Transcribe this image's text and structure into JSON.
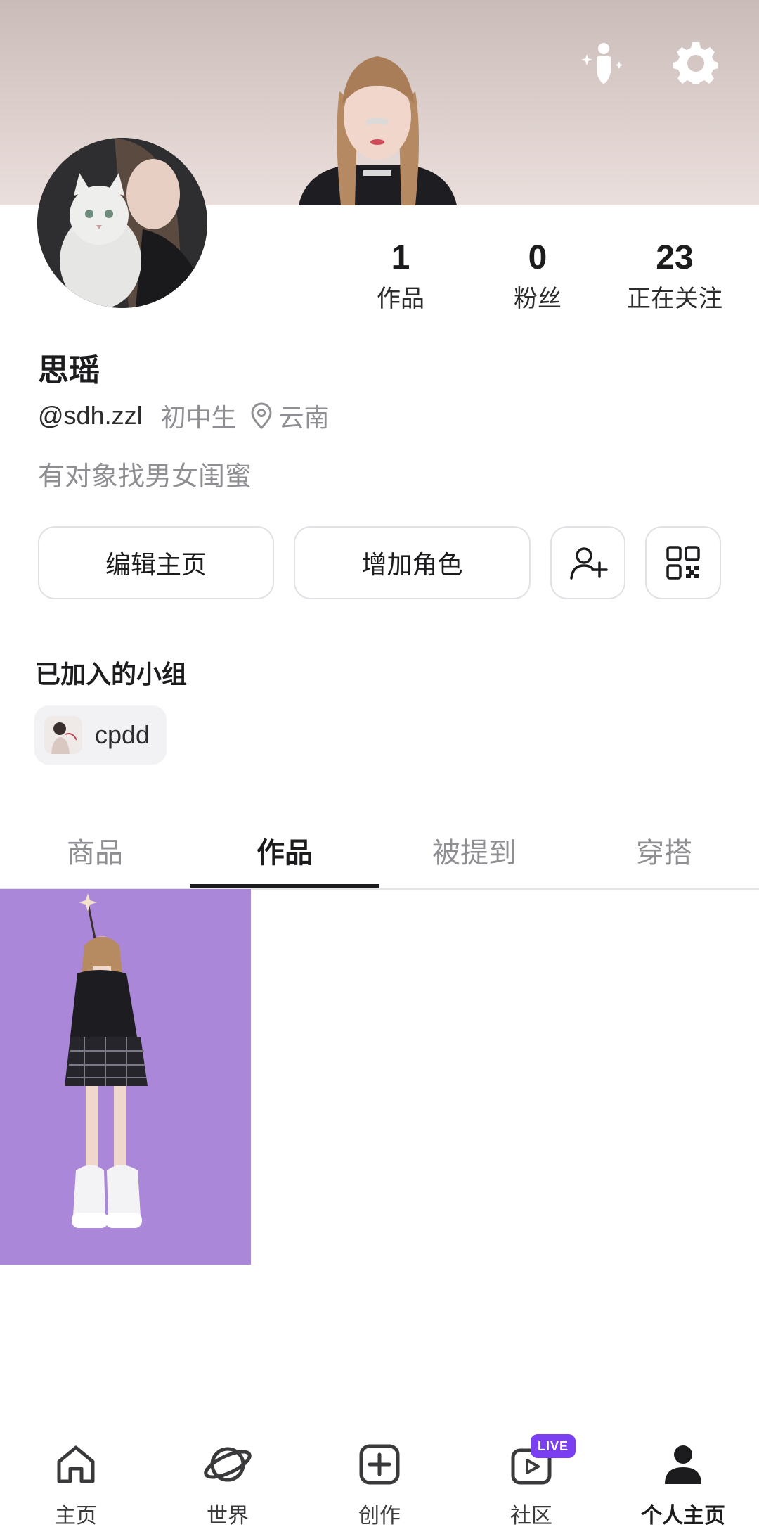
{
  "header": {
    "top_icons": [
      "avatar-sparkle-icon",
      "gear-icon"
    ]
  },
  "profile": {
    "name": "思瑶",
    "handle": "@sdh.zzl",
    "grade": "初中生",
    "location": "云南",
    "bio": "有对象找男女闺蜜"
  },
  "stats": [
    {
      "value": "1",
      "label": "作品"
    },
    {
      "value": "0",
      "label": "粉丝"
    },
    {
      "value": "23",
      "label": "正在关注"
    }
  ],
  "actions": {
    "edit_label": "编辑主页",
    "add_role_label": "增加角色",
    "add_friend_icon": "add-user-icon",
    "qr_icon": "qr-code-icon"
  },
  "groups": {
    "title": "已加入的小组",
    "items": [
      {
        "name": "cpdd"
      }
    ]
  },
  "tabs": [
    {
      "label": "商品",
      "active": false
    },
    {
      "label": "作品",
      "active": true
    },
    {
      "label": "被提到",
      "active": false
    },
    {
      "label": "穿搭",
      "active": false
    }
  ],
  "works": {
    "card_background": "#ab87d9"
  },
  "bottom_nav": {
    "items": [
      {
        "label": "主页",
        "icon": "home-icon"
      },
      {
        "label": "世界",
        "icon": "planet-icon"
      },
      {
        "label": "创作",
        "icon": "create-plus-icon"
      },
      {
        "label": "社区",
        "icon": "community-play-icon"
      },
      {
        "label": "个人主页",
        "icon": "profile-icon",
        "active": true
      }
    ],
    "live_badge": "LIVE"
  },
  "colors": {
    "live_badge": "#7b3ff2",
    "text_primary": "#1c1c1e",
    "text_secondary": "#8e8e93"
  }
}
